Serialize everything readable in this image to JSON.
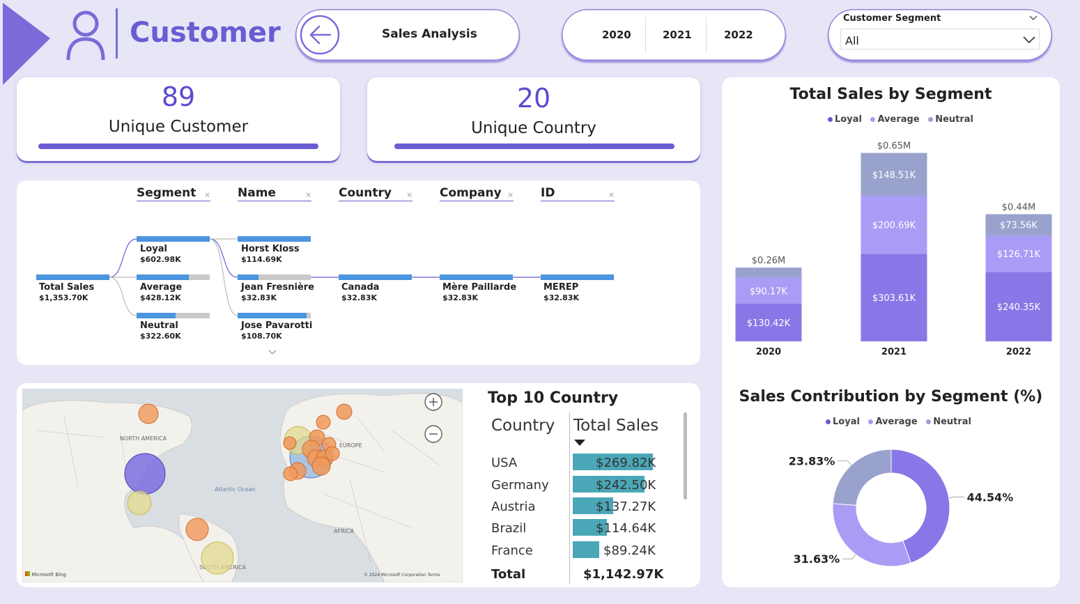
{
  "header": {
    "title": "Customer",
    "nav_button_label": "Sales Analysis",
    "years": [
      "2020",
      "2021",
      "2022"
    ],
    "segment_filter": {
      "label": "Customer Segment",
      "value": "All"
    }
  },
  "kpis": {
    "customers": {
      "value": "89",
      "label": "Unique Customer"
    },
    "countries": {
      "value": "20",
      "label": "Unique Country"
    }
  },
  "decomposition_tree": {
    "levels": [
      "Segment",
      "Name",
      "Country",
      "Company",
      "ID"
    ],
    "root": {
      "label": "Total Sales",
      "value": "$1,353.70K"
    },
    "segments": [
      {
        "label": "Loyal",
        "value": "$602.98K"
      },
      {
        "label": "Average",
        "value": "$428.12K"
      },
      {
        "label": "Neutral",
        "value": "$322.60K"
      }
    ],
    "names": [
      {
        "label": "Horst Kloss",
        "value": "$114.69K"
      },
      {
        "label": "Jean Fresnière",
        "value": "$32.83K"
      },
      {
        "label": "Jose Pavarotti",
        "value": "$108.70K"
      }
    ],
    "country": {
      "label": "Canada",
      "value": "$32.83K"
    },
    "company": {
      "label": "Mère Paillarde",
      "value": "$32.83K"
    },
    "id": {
      "label": "MEREP",
      "value": "$32.83K"
    }
  },
  "map": {
    "labels": [
      "NORTH AMERICA",
      "Atlantic Ocean",
      "EUROPE",
      "AFRICA",
      "SOUTH AMERICA"
    ],
    "attribution": "Microsoft Bing",
    "copyright": "© 2024 Microsoft Corporation Terms"
  },
  "top10": {
    "title": "Top 10 Country",
    "col_country": "Country",
    "col_sales": "Total Sales",
    "rows": [
      {
        "country": "USA",
        "sales": "$269.82K",
        "value": 269.82
      },
      {
        "country": "Germany",
        "sales": "$242.50K",
        "value": 242.5
      },
      {
        "country": "Austria",
        "sales": "$137.27K",
        "value": 137.27
      },
      {
        "country": "Brazil",
        "sales": "$114.64K",
        "value": 114.64
      },
      {
        "country": "France",
        "sales": "$89.24K",
        "value": 89.24
      }
    ],
    "total_label": "Total",
    "total_value": "$1,142.97K"
  },
  "chart_data": [
    {
      "type": "bar",
      "stacked": true,
      "title": "Total Sales by Segment",
      "categories": [
        "2020",
        "2021",
        "2022"
      ],
      "totals": [
        "$0.26M",
        "$0.65M",
        "$0.44M"
      ],
      "series": [
        {
          "name": "Loyal",
          "color": "#8877e6",
          "values": [
            130.42,
            303.61,
            240.35
          ],
          "labels": [
            "$130.42K",
            "$303.61K",
            "$240.35K"
          ]
        },
        {
          "name": "Average",
          "color": "#a99cf5",
          "values": [
            90.17,
            200.69,
            126.71
          ],
          "labels": [
            "$90.17K",
            "$200.69K",
            "$126.71K"
          ]
        },
        {
          "name": "Neutral",
          "color": "#99a2cc",
          "values": [
            35.0,
            148.51,
            73.56
          ],
          "labels": [
            "",
            "$148.51K",
            "$73.56K"
          ]
        }
      ],
      "legend": "top-center"
    },
    {
      "type": "pie",
      "donut": true,
      "title": "Sales Contribution by Segment (%)",
      "slices": [
        {
          "name": "Loyal",
          "value": 44.54,
          "label": "44.54%",
          "color": "#8877e6"
        },
        {
          "name": "Average",
          "value": 31.63,
          "label": "31.63%",
          "color": "#a99cf5"
        },
        {
          "name": "Neutral",
          "value": 23.83,
          "label": "23.83%",
          "color": "#99a2cc"
        }
      ],
      "legend": "top-center"
    }
  ]
}
